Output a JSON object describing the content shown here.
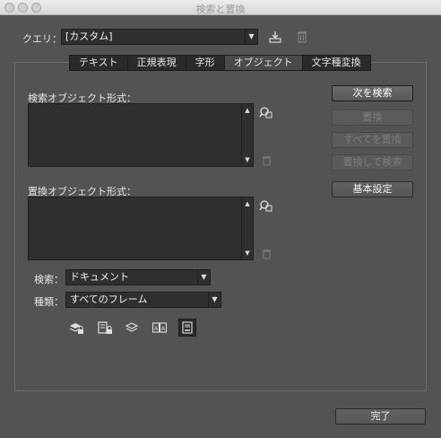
{
  "window": {
    "title": "検索と置換"
  },
  "query": {
    "label": "クエリ：",
    "value": "[カスタム]"
  },
  "tabs": [
    {
      "label": "テキスト",
      "active": false
    },
    {
      "label": "正規表現",
      "active": false
    },
    {
      "label": "字形",
      "active": false
    },
    {
      "label": "オブジェクト",
      "active": true
    },
    {
      "label": "文字種変換",
      "active": false
    }
  ],
  "find": {
    "label": "検索オブジェクト形式："
  },
  "change": {
    "label": "置換オブジェクト形式："
  },
  "buttons": {
    "find_next": "次を検索",
    "change": "置換",
    "change_all": "すべてを置換",
    "change_find": "置換して検索",
    "basic_settings": "基本設定",
    "done": "完了"
  },
  "search": {
    "label": "検索：",
    "value": "ドキュメント"
  },
  "type": {
    "label": "種類：",
    "value": "すべてのフレーム"
  },
  "icons": [
    "locked-layers-icon",
    "locked-stories-icon",
    "hidden-layers-icon",
    "master-pages-icon",
    "footnotes-icon"
  ],
  "colors": {
    "background": "#535353",
    "field": "#2f2f2f",
    "disabled_text": "#7e7e7e"
  }
}
